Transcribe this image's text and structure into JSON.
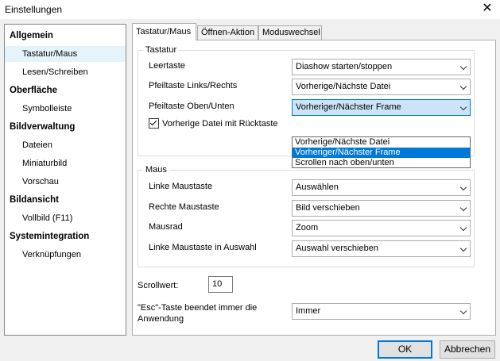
{
  "window": {
    "title": "Einstellungen",
    "close_symbol": "✕"
  },
  "sidebar": {
    "items": [
      {
        "label": "Allgemein",
        "type": "category"
      },
      {
        "label": "Tastatur/Maus",
        "type": "child",
        "selected": true
      },
      {
        "label": "Lesen/Schreiben",
        "type": "child"
      },
      {
        "label": "Oberfläche",
        "type": "category"
      },
      {
        "label": "Symbolleiste",
        "type": "child"
      },
      {
        "label": "Bildverwaltung",
        "type": "category"
      },
      {
        "label": "Dateien",
        "type": "child"
      },
      {
        "label": "Miniaturbild",
        "type": "child"
      },
      {
        "label": "Vorschau",
        "type": "child"
      },
      {
        "label": "Bildansicht",
        "type": "category"
      },
      {
        "label": "Vollbild  (F11)",
        "type": "child"
      },
      {
        "label": "Systemintegration",
        "type": "category"
      },
      {
        "label": "Verknüpfungen",
        "type": "child"
      }
    ]
  },
  "tabs": [
    {
      "label": "Tastatur/Maus",
      "active": true
    },
    {
      "label": "Öffnen-Aktion"
    },
    {
      "label": "Moduswechsel"
    }
  ],
  "keyboard": {
    "title": "Tastatur",
    "space": {
      "label": "Leertaste",
      "value": "Diashow starten/stoppen"
    },
    "arrows_lr": {
      "label": "Pfeiltaste Links/Rechts",
      "value": "Vorherige/Nächste Datei"
    },
    "arrows_ud": {
      "label": "Pfeiltaste Oben/Unten",
      "value": "Vorheriger/Nächster Frame"
    },
    "backspace_checkbox": {
      "label": "Vorherige Datei mit Rücktaste",
      "checked": true
    }
  },
  "dropdown": {
    "options": [
      "Vorherige/Nächste Datei",
      "Vorheriger/Nächster Frame",
      "Scrollen nach oben/unten"
    ],
    "highlighted_index": 1
  },
  "mouse": {
    "title": "Maus",
    "left_button": {
      "label": "Linke Maustaste",
      "value": "Auswählen"
    },
    "right_button": {
      "label": "Rechte Maustaste",
      "value": "Bild verschieben"
    },
    "wheel": {
      "label": "Mausrad",
      "value": "Zoom"
    },
    "left_in_selection": {
      "label": "Linke Maustaste in Auswahl",
      "value": "Auswahl verschieben"
    }
  },
  "scroll": {
    "label": "Scrollwert:",
    "value": "10"
  },
  "esc": {
    "label_line1": "\"Esc\"-Taste beendet immer die",
    "label_line2": "Anwendung",
    "value": "Immer"
  },
  "buttons": {
    "ok": "OK",
    "cancel": "Abbrechen"
  },
  "colors": {
    "accent": "#0078d7",
    "selection_bg": "#e5f3fb",
    "focused_combo_bg": "#cce4f7"
  }
}
